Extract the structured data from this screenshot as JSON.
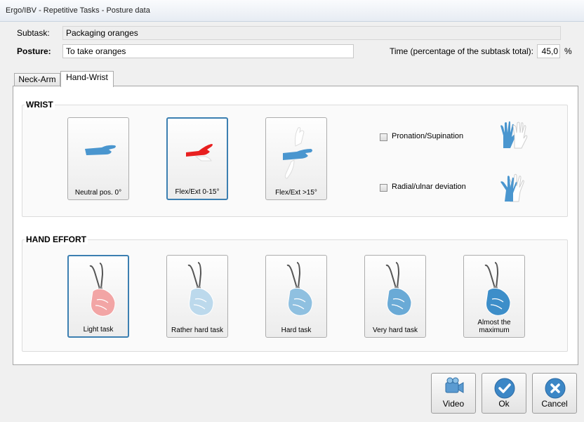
{
  "window": {
    "title": "Ergo/IBV - Repetitive Tasks - Posture data"
  },
  "form": {
    "subtask_label": "Subtask:",
    "subtask_value": "Packaging oranges",
    "posture_label": "Posture:",
    "posture_value": "To take oranges",
    "time_label": "Time (percentage of the subtask total):",
    "time_value": "45,0",
    "time_unit": "%"
  },
  "tabs": [
    {
      "label": "Neck-Arm",
      "active": false
    },
    {
      "label": "Hand-Wrist",
      "active": true
    }
  ],
  "wrist": {
    "title": "WRIST",
    "tiles": [
      {
        "label": "Neutral pos. 0°",
        "selected": false,
        "icon": "hand-neutral-icon"
      },
      {
        "label": "Flex/Ext 0-15°",
        "selected": true,
        "icon": "hand-flex-small-icon",
        "color": "#e82020"
      },
      {
        "label": "Flex/Ext >15°",
        "selected": false,
        "icon": "hand-flex-large-icon"
      }
    ],
    "options": [
      {
        "label": "Pronation/Supination",
        "checked": false,
        "icon": "pronation-icon"
      },
      {
        "label": "Radial/ulnar deviation",
        "checked": false,
        "icon": "deviation-icon"
      }
    ]
  },
  "hand_effort": {
    "title": "HAND EFFORT",
    "tiles": [
      {
        "label": "Light task",
        "selected": true,
        "color": "#f2a5a5"
      },
      {
        "label": "Rather hard task",
        "selected": false,
        "color": "#bcd9ec"
      },
      {
        "label": "Hard task",
        "selected": false,
        "color": "#8fc0e0"
      },
      {
        "label": "Very hard task",
        "selected": false,
        "color": "#6aaad6"
      },
      {
        "label": "Almost the maximum",
        "selected": false,
        "color": "#3d8ec9"
      }
    ]
  },
  "buttons": {
    "video": "Video",
    "ok": "Ok",
    "cancel": "Cancel"
  },
  "colors": {
    "accent": "#3c7fb1",
    "hand_blue": "#4a96cf",
    "selected_red": "#e82020"
  }
}
